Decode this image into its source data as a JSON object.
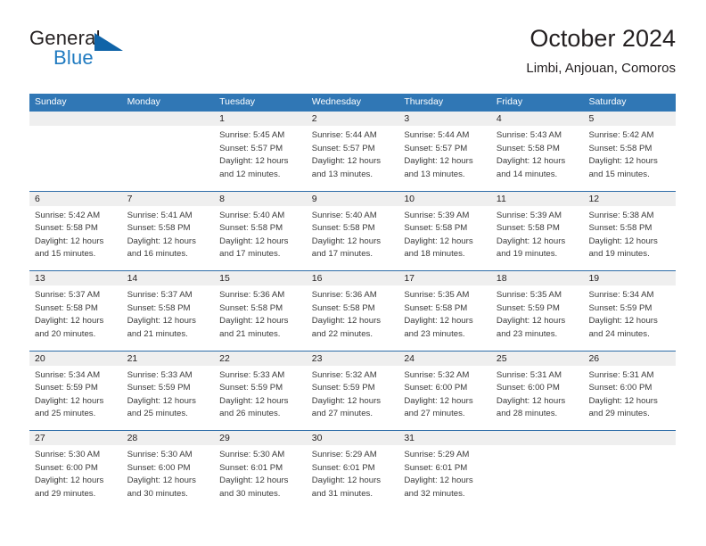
{
  "brand": {
    "word1": "General",
    "word2": "Blue",
    "logo_icon": "blue-triangle-logo-icon",
    "accent_color": "#1f7ac0"
  },
  "header": {
    "title": "October 2024",
    "subtitle": "Limbi, Anjouan, Comoros"
  },
  "theme": {
    "header_bg": "#3077b5",
    "row_divider": "#2e6da8",
    "date_strip_bg": "#efefef",
    "text": "#231f20"
  },
  "weekday_headers": [
    "Sunday",
    "Monday",
    "Tuesday",
    "Wednesday",
    "Thursday",
    "Friday",
    "Saturday"
  ],
  "labels": {
    "sunrise_prefix": "Sunrise:",
    "sunset_prefix": "Sunset:",
    "daylight_prefix": "Daylight:"
  },
  "weeks": [
    [
      {
        "date": "",
        "sunrise": "",
        "sunset": "",
        "daylight_a": "",
        "daylight_b": ""
      },
      {
        "date": "",
        "sunrise": "",
        "sunset": "",
        "daylight_a": "",
        "daylight_b": ""
      },
      {
        "date": "1",
        "sunrise": "Sunrise: 5:45 AM",
        "sunset": "Sunset: 5:57 PM",
        "daylight_a": "Daylight: 12 hours",
        "daylight_b": "and 12 minutes."
      },
      {
        "date": "2",
        "sunrise": "Sunrise: 5:44 AM",
        "sunset": "Sunset: 5:57 PM",
        "daylight_a": "Daylight: 12 hours",
        "daylight_b": "and 13 minutes."
      },
      {
        "date": "3",
        "sunrise": "Sunrise: 5:44 AM",
        "sunset": "Sunset: 5:57 PM",
        "daylight_a": "Daylight: 12 hours",
        "daylight_b": "and 13 minutes."
      },
      {
        "date": "4",
        "sunrise": "Sunrise: 5:43 AM",
        "sunset": "Sunset: 5:58 PM",
        "daylight_a": "Daylight: 12 hours",
        "daylight_b": "and 14 minutes."
      },
      {
        "date": "5",
        "sunrise": "Sunrise: 5:42 AM",
        "sunset": "Sunset: 5:58 PM",
        "daylight_a": "Daylight: 12 hours",
        "daylight_b": "and 15 minutes."
      }
    ],
    [
      {
        "date": "6",
        "sunrise": "Sunrise: 5:42 AM",
        "sunset": "Sunset: 5:58 PM",
        "daylight_a": "Daylight: 12 hours",
        "daylight_b": "and 15 minutes."
      },
      {
        "date": "7",
        "sunrise": "Sunrise: 5:41 AM",
        "sunset": "Sunset: 5:58 PM",
        "daylight_a": "Daylight: 12 hours",
        "daylight_b": "and 16 minutes."
      },
      {
        "date": "8",
        "sunrise": "Sunrise: 5:40 AM",
        "sunset": "Sunset: 5:58 PM",
        "daylight_a": "Daylight: 12 hours",
        "daylight_b": "and 17 minutes."
      },
      {
        "date": "9",
        "sunrise": "Sunrise: 5:40 AM",
        "sunset": "Sunset: 5:58 PM",
        "daylight_a": "Daylight: 12 hours",
        "daylight_b": "and 17 minutes."
      },
      {
        "date": "10",
        "sunrise": "Sunrise: 5:39 AM",
        "sunset": "Sunset: 5:58 PM",
        "daylight_a": "Daylight: 12 hours",
        "daylight_b": "and 18 minutes."
      },
      {
        "date": "11",
        "sunrise": "Sunrise: 5:39 AM",
        "sunset": "Sunset: 5:58 PM",
        "daylight_a": "Daylight: 12 hours",
        "daylight_b": "and 19 minutes."
      },
      {
        "date": "12",
        "sunrise": "Sunrise: 5:38 AM",
        "sunset": "Sunset: 5:58 PM",
        "daylight_a": "Daylight: 12 hours",
        "daylight_b": "and 19 minutes."
      }
    ],
    [
      {
        "date": "13",
        "sunrise": "Sunrise: 5:37 AM",
        "sunset": "Sunset: 5:58 PM",
        "daylight_a": "Daylight: 12 hours",
        "daylight_b": "and 20 minutes."
      },
      {
        "date": "14",
        "sunrise": "Sunrise: 5:37 AM",
        "sunset": "Sunset: 5:58 PM",
        "daylight_a": "Daylight: 12 hours",
        "daylight_b": "and 21 minutes."
      },
      {
        "date": "15",
        "sunrise": "Sunrise: 5:36 AM",
        "sunset": "Sunset: 5:58 PM",
        "daylight_a": "Daylight: 12 hours",
        "daylight_b": "and 21 minutes."
      },
      {
        "date": "16",
        "sunrise": "Sunrise: 5:36 AM",
        "sunset": "Sunset: 5:58 PM",
        "daylight_a": "Daylight: 12 hours",
        "daylight_b": "and 22 minutes."
      },
      {
        "date": "17",
        "sunrise": "Sunrise: 5:35 AM",
        "sunset": "Sunset: 5:58 PM",
        "daylight_a": "Daylight: 12 hours",
        "daylight_b": "and 23 minutes."
      },
      {
        "date": "18",
        "sunrise": "Sunrise: 5:35 AM",
        "sunset": "Sunset: 5:59 PM",
        "daylight_a": "Daylight: 12 hours",
        "daylight_b": "and 23 minutes."
      },
      {
        "date": "19",
        "sunrise": "Sunrise: 5:34 AM",
        "sunset": "Sunset: 5:59 PM",
        "daylight_a": "Daylight: 12 hours",
        "daylight_b": "and 24 minutes."
      }
    ],
    [
      {
        "date": "20",
        "sunrise": "Sunrise: 5:34 AM",
        "sunset": "Sunset: 5:59 PM",
        "daylight_a": "Daylight: 12 hours",
        "daylight_b": "and 25 minutes."
      },
      {
        "date": "21",
        "sunrise": "Sunrise: 5:33 AM",
        "sunset": "Sunset: 5:59 PM",
        "daylight_a": "Daylight: 12 hours",
        "daylight_b": "and 25 minutes."
      },
      {
        "date": "22",
        "sunrise": "Sunrise: 5:33 AM",
        "sunset": "Sunset: 5:59 PM",
        "daylight_a": "Daylight: 12 hours",
        "daylight_b": "and 26 minutes."
      },
      {
        "date": "23",
        "sunrise": "Sunrise: 5:32 AM",
        "sunset": "Sunset: 5:59 PM",
        "daylight_a": "Daylight: 12 hours",
        "daylight_b": "and 27 minutes."
      },
      {
        "date": "24",
        "sunrise": "Sunrise: 5:32 AM",
        "sunset": "Sunset: 6:00 PM",
        "daylight_a": "Daylight: 12 hours",
        "daylight_b": "and 27 minutes."
      },
      {
        "date": "25",
        "sunrise": "Sunrise: 5:31 AM",
        "sunset": "Sunset: 6:00 PM",
        "daylight_a": "Daylight: 12 hours",
        "daylight_b": "and 28 minutes."
      },
      {
        "date": "26",
        "sunrise": "Sunrise: 5:31 AM",
        "sunset": "Sunset: 6:00 PM",
        "daylight_a": "Daylight: 12 hours",
        "daylight_b": "and 29 minutes."
      }
    ],
    [
      {
        "date": "27",
        "sunrise": "Sunrise: 5:30 AM",
        "sunset": "Sunset: 6:00 PM",
        "daylight_a": "Daylight: 12 hours",
        "daylight_b": "and 29 minutes."
      },
      {
        "date": "28",
        "sunrise": "Sunrise: 5:30 AM",
        "sunset": "Sunset: 6:00 PM",
        "daylight_a": "Daylight: 12 hours",
        "daylight_b": "and 30 minutes."
      },
      {
        "date": "29",
        "sunrise": "Sunrise: 5:30 AM",
        "sunset": "Sunset: 6:01 PM",
        "daylight_a": "Daylight: 12 hours",
        "daylight_b": "and 30 minutes."
      },
      {
        "date": "30",
        "sunrise": "Sunrise: 5:29 AM",
        "sunset": "Sunset: 6:01 PM",
        "daylight_a": "Daylight: 12 hours",
        "daylight_b": "and 31 minutes."
      },
      {
        "date": "31",
        "sunrise": "Sunrise: 5:29 AM",
        "sunset": "Sunset: 6:01 PM",
        "daylight_a": "Daylight: 12 hours",
        "daylight_b": "and 32 minutes."
      },
      {
        "date": "",
        "sunrise": "",
        "sunset": "",
        "daylight_a": "",
        "daylight_b": ""
      },
      {
        "date": "",
        "sunrise": "",
        "sunset": "",
        "daylight_a": "",
        "daylight_b": ""
      }
    ]
  ]
}
